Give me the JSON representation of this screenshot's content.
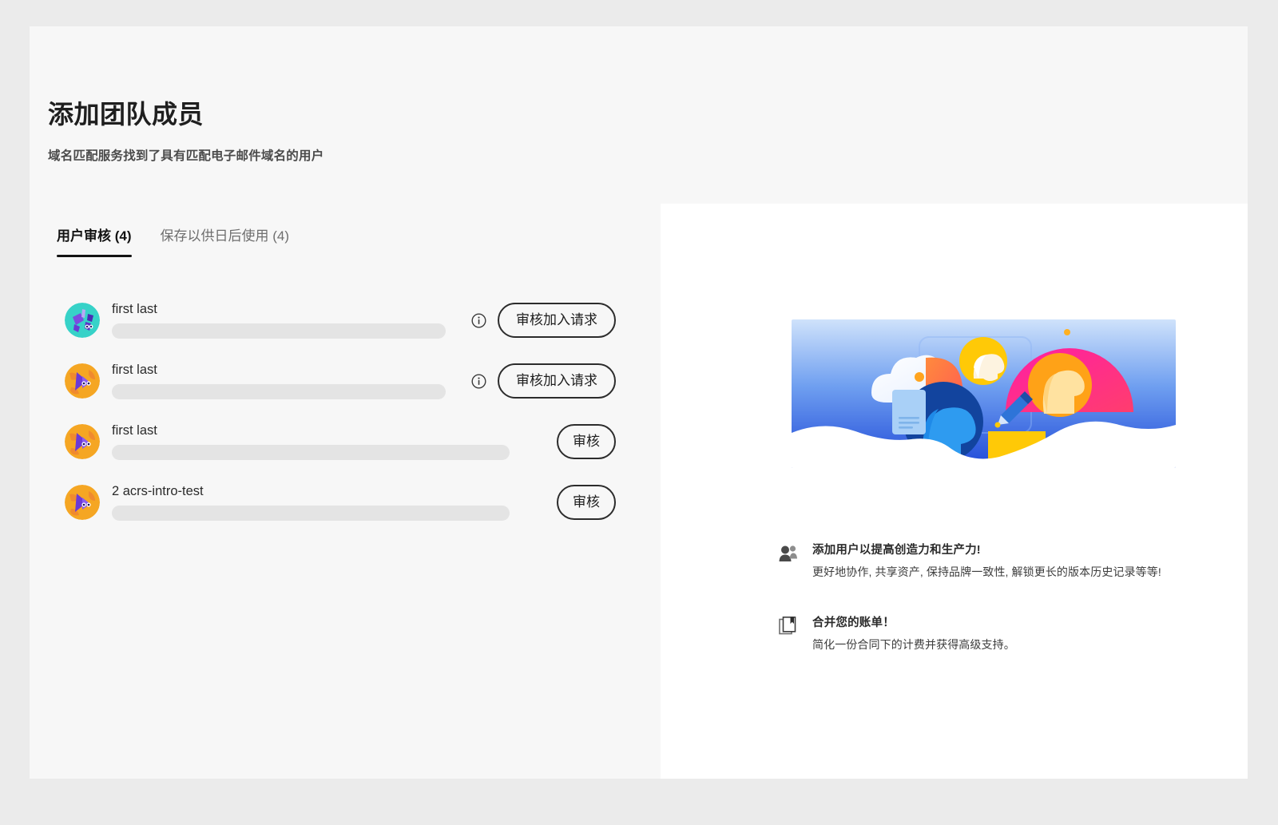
{
  "header": {
    "title": "添加团队成员",
    "subtitle": "域名匹配服务找到了具有匹配电子邮件域名的用户"
  },
  "tabs": [
    {
      "label": "用户审核 (4)",
      "active": true
    },
    {
      "label": "保存以供日后使用 (4)",
      "active": false
    }
  ],
  "users": [
    {
      "name": "first last",
      "email_redacted": true,
      "has_info_icon": true,
      "action_label": "审核加入请求",
      "avatar_style": "teal",
      "redact_width": "long"
    },
    {
      "name": "first last",
      "email_redacted": true,
      "has_info_icon": true,
      "action_label": "审核加入请求",
      "avatar_style": "orange",
      "redact_width": "long"
    },
    {
      "name": "first last",
      "email_redacted": true,
      "has_info_icon": false,
      "action_label": "审核",
      "avatar_style": "orange",
      "redact_width": "short"
    },
    {
      "name": "2 acrs-intro-test",
      "email_redacted": true,
      "has_info_icon": false,
      "action_label": "审核",
      "avatar_style": "orange",
      "redact_width": "short"
    }
  ],
  "promo": {
    "hero_alt": "team collaboration illustration",
    "benefits": [
      {
        "icon": "users-icon",
        "title": "添加用户以提高创造力和生产力!",
        "desc": "更好地协作, 共享资产, 保持品牌一致性, 解锁更长的版本历史记录等等!"
      },
      {
        "icon": "bookmark-document-icon",
        "title": "合并您的账单！",
        "desc": "简化一份合同下的计费并获得高级支持。"
      }
    ]
  },
  "colors": {
    "page_bg": "#ebebeb",
    "card_bg": "#f7f7f7",
    "panel_bg": "#ffffff",
    "text_primary": "#1f1f1f",
    "text_secondary": "#6e6e6e",
    "redact_bar": "#e4e4e4",
    "button_border": "#2c2c2c"
  }
}
